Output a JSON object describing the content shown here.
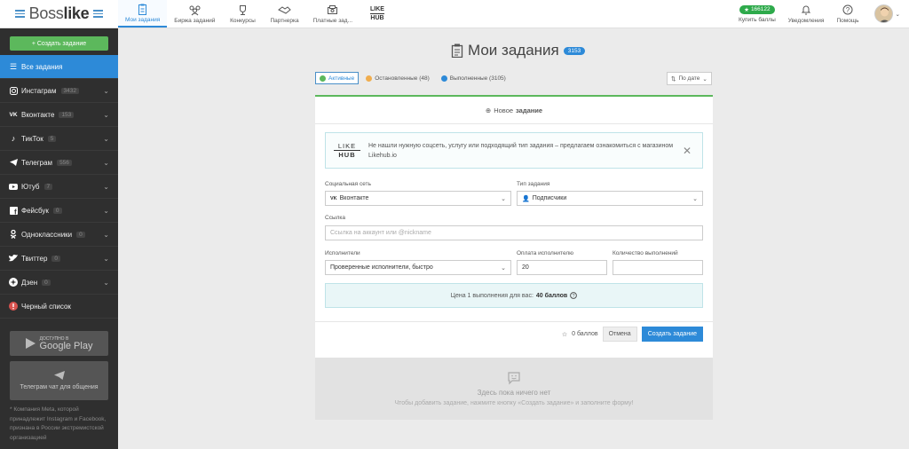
{
  "header": {
    "logo_left": "Boss",
    "logo_right": "like",
    "nav": [
      {
        "label": "Мои задания",
        "icon": "clipboard-icon"
      },
      {
        "label": "Биржа заданий",
        "icon": "people-icon"
      },
      {
        "label": "Конкурсы",
        "icon": "trophy-icon"
      },
      {
        "label": "Партнерка",
        "icon": "handshake-icon"
      },
      {
        "label": "Платные зад...",
        "icon": "money-icon"
      }
    ],
    "likehub_top": "LIKE",
    "likehub_bottom": "HUB",
    "balance": "166122",
    "buy_label": "Купить баллы",
    "notifications_label": "Уведомления",
    "help_label": "Помощь"
  },
  "sidebar": {
    "create_label": "+ Создать задание",
    "items": [
      {
        "label": "Все задания",
        "count": "",
        "icon": "list-icon"
      },
      {
        "label": "Инстаграм",
        "count": "3432",
        "icon": "instagram-icon"
      },
      {
        "label": "Вконтакте",
        "count": "153",
        "icon": "vk-icon"
      },
      {
        "label": "ТикТок",
        "count": "5",
        "icon": "tiktok-icon"
      },
      {
        "label": "Телеграм",
        "count": "556",
        "icon": "telegram-icon"
      },
      {
        "label": "Ютуб",
        "count": "7",
        "icon": "youtube-icon"
      },
      {
        "label": "Фейсбук",
        "count": "0",
        "icon": "facebook-icon"
      },
      {
        "label": "Одноклассники",
        "count": "0",
        "icon": "ok-icon"
      },
      {
        "label": "Твиттер",
        "count": "0",
        "icon": "twitter-icon"
      },
      {
        "label": "Дзен",
        "count": "0",
        "icon": "zen-icon"
      },
      {
        "label": "Черный список",
        "count": "",
        "icon": "blacklist-icon"
      }
    ],
    "gp_small": "ДОСТУПНО В",
    "gp_big": "Google Play",
    "tg_chat": "Телеграм чат для общения",
    "note": "* Компания Meta, которой принадлежит Instagram и Facebook, признана в России экстремистской организацией"
  },
  "main": {
    "title": "Мои задания",
    "title_count": "3153",
    "tabs": [
      {
        "label": "Активные",
        "color": "#5cb85c"
      },
      {
        "label": "Остановленные (48)",
        "color": "#f0ad4e"
      },
      {
        "label": "Выполненные (3105)",
        "color": "#2d8ad8"
      }
    ],
    "sort_label": "По дате",
    "new_task_prefix": "Новое",
    "new_task_bold": "задание",
    "promo_top": "LIKE",
    "promo_bottom": "HUB",
    "promo_text": "Не нашли нужную соцсеть, услугу или подходящий тип задания – предлагаем ознакомиться с магазином Likehub.io",
    "form": {
      "network_label": "Социальная сеть",
      "network_value": "Вконтакте",
      "type_label": "Тип задания",
      "type_value": "Подписчики",
      "link_label": "Ссылка",
      "link_placeholder": "Ссылка на аккаунт или @nickname",
      "executors_label": "Исполнители",
      "executors_value": "Проверенные исполнители, быстро",
      "pay_label": "Оплата исполнителю",
      "pay_value": "20",
      "qty_label": "Количество выполнений",
      "qty_value": ""
    },
    "price_text": "Цена 1 выполнения для вас:",
    "price_value": "40 баллов",
    "points_label": "0 баллов",
    "cancel_label": "Отмена",
    "create_label": "Создать задание",
    "empty_title": "Здесь пока ничего нет",
    "empty_hint": "Чтобы добавить задание, нажмите кнопку «Создать задание» и заполните форму!"
  }
}
